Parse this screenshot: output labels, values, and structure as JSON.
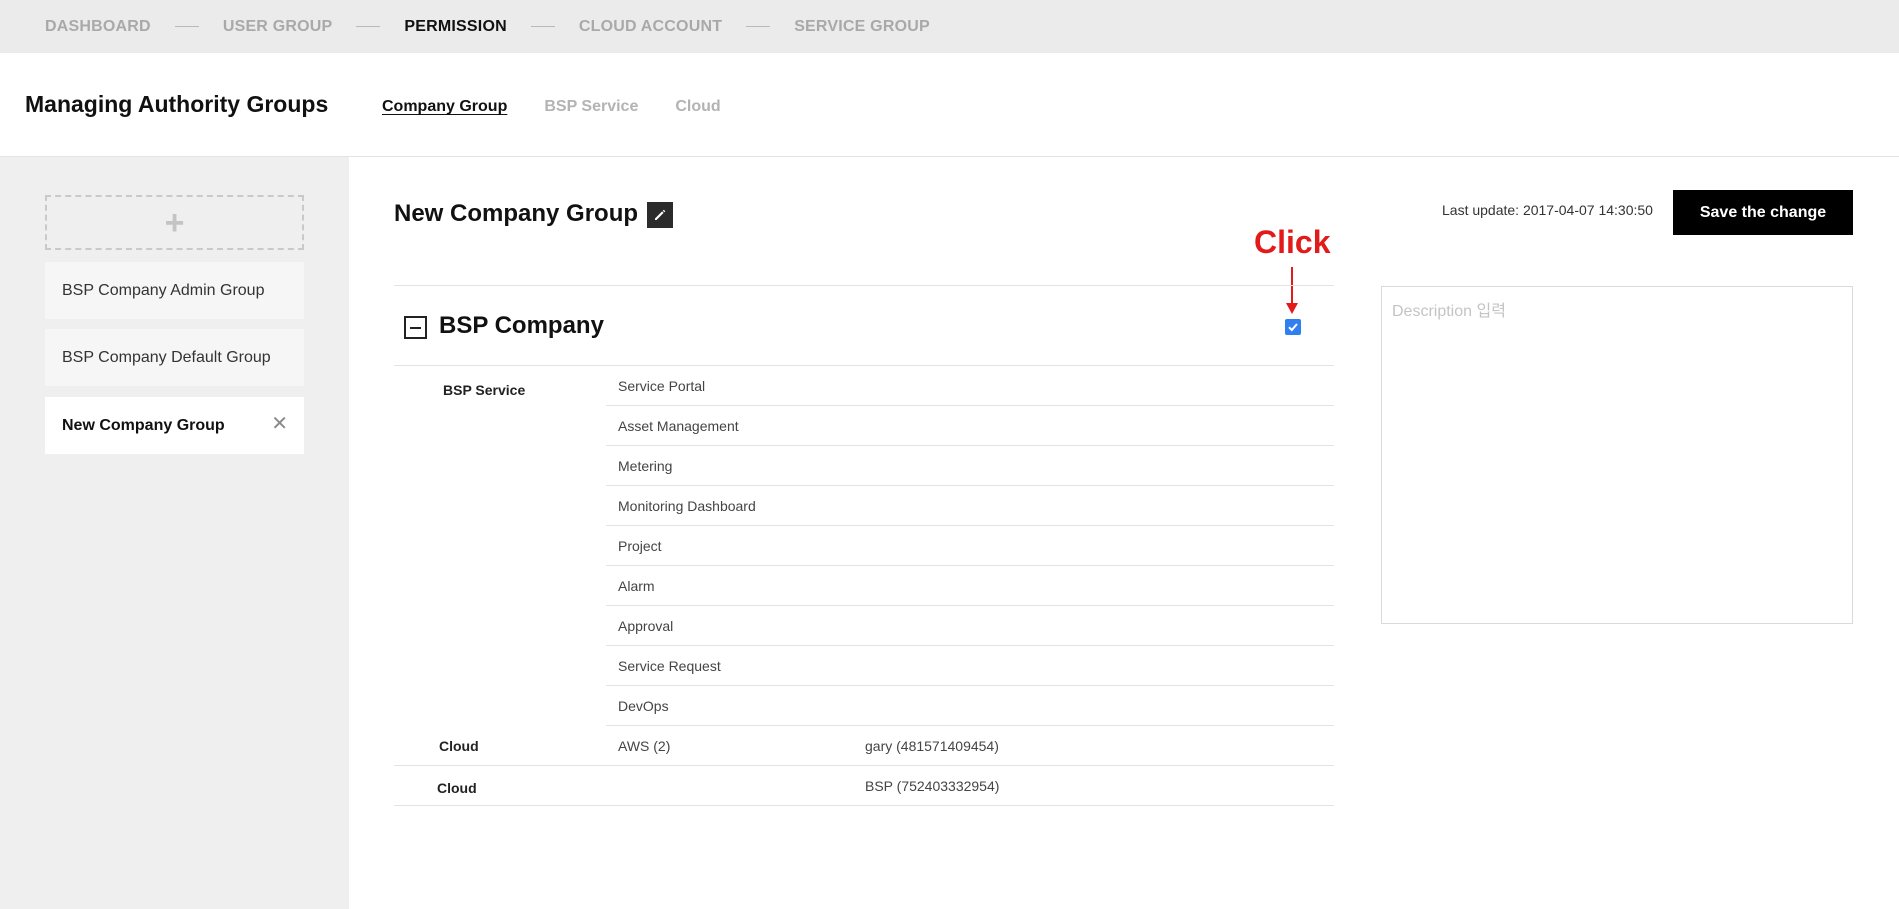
{
  "steps": [
    "DASHBOARD",
    "USER GROUP",
    "PERMISSION",
    "CLOUD ACCOUNT",
    "SERVICE GROUP"
  ],
  "active_step": "PERMISSION",
  "header": {
    "title": "Managing Authority Groups",
    "tabs": [
      "Company Group",
      "BSP Service",
      "Cloud"
    ],
    "active_tab": "Company Group"
  },
  "sidebar": {
    "add_icon": "plus-icon",
    "groups": [
      "BSP Company Admin Group",
      "BSP Company Default Group",
      "New Company Group"
    ],
    "selected_group": "New Company Group"
  },
  "main": {
    "group_name": "New Company Group",
    "last_update": "Last update: 2017-04-07 14:30:50",
    "save_label": "Save the change",
    "annotation": "Click",
    "description_placeholder": "Description 입력",
    "section": {
      "title": "BSP Company",
      "checked": true,
      "bsp_service_label": "BSP Service",
      "services": [
        "Service Portal",
        "Asset Management",
        "Metering",
        "Monitoring Dashboard",
        "Project",
        "Alarm",
        "Approval",
        "Service Request",
        "DevOps"
      ],
      "cloud_rows": [
        {
          "label": "Cloud",
          "type": "AWS (2)",
          "account": "gary (481571409454)"
        },
        {
          "label": "Cloud",
          "type": "",
          "account": "BSP (752403332954)"
        }
      ]
    }
  },
  "colors": {
    "accent_checkbox": "#2f7ff0",
    "annotation_red": "#e21a1a",
    "sidebar_bg": "#efefef",
    "steps_bg": "#ebebeb"
  }
}
